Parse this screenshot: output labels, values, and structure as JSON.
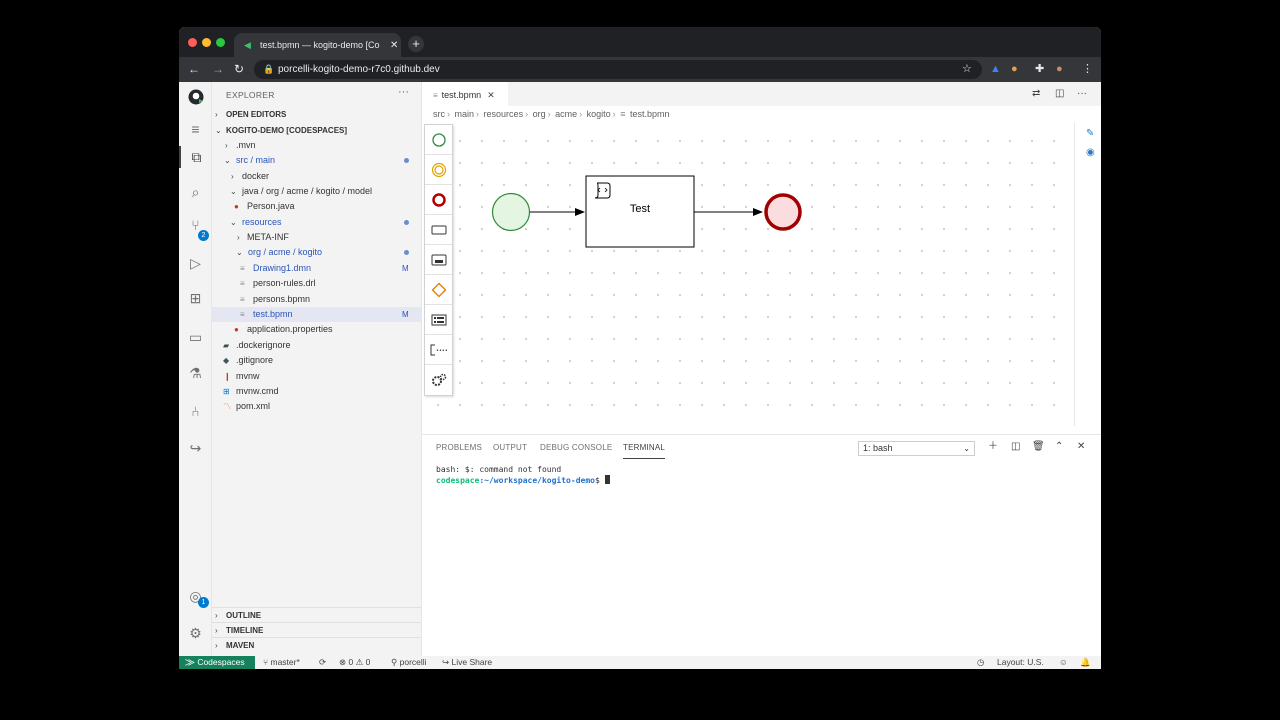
{
  "browser": {
    "tab_title": "test.bpmn — kogito-demo [Co",
    "tab_close": "✕",
    "new_tab": "+",
    "url": "porcelli-kogito-demo-r7c0.github.dev",
    "traffic_colors": [
      "#ff5f57",
      "#febc2e",
      "#28c840"
    ]
  },
  "sidebar": {
    "title": "EXPLORER",
    "more": "···",
    "open_editors": "OPEN EDITORS",
    "workspace": "KOGITO-DEMO [CODESPACES]",
    "tree": [
      {
        "label": ".mvn",
        "modified": false
      },
      {
        "label": "src / main",
        "modified": true
      },
      {
        "label": "docker",
        "modified": false
      },
      {
        "label": "java / org / acme / kogito / model",
        "modified": false
      },
      {
        "label": "Person.java",
        "modified": false
      },
      {
        "label": "resources",
        "modified": true
      },
      {
        "label": "META-INF",
        "modified": false
      },
      {
        "label": "org / acme / kogito",
        "modified": true
      },
      {
        "label": "Drawing1.dmn",
        "modified": true,
        "badge": "M"
      },
      {
        "label": "person-rules.drl",
        "modified": false
      },
      {
        "label": "persons.bpmn",
        "modified": false
      },
      {
        "label": "test.bpmn",
        "modified": true,
        "badge": "M"
      },
      {
        "label": "application.properties",
        "modified": false
      },
      {
        "label": ".dockerignore",
        "modified": false
      },
      {
        "label": ".gitignore",
        "modified": false
      },
      {
        "label": "mvnw",
        "modified": false
      },
      {
        "label": "mvnw.cmd",
        "modified": false
      },
      {
        "label": "pom.xml",
        "modified": false
      }
    ],
    "outline": "OUTLINE",
    "timeline": "TIMELINE",
    "maven": "MAVEN"
  },
  "activity_badges": {
    "scm": "2",
    "accounts": "1"
  },
  "editor": {
    "tab_label": "test.bpmn",
    "breadcrumb": [
      "src",
      "main",
      "resources",
      "org",
      "acme",
      "kogito",
      "test.bpmn"
    ],
    "diagram": {
      "task_label": "Test"
    }
  },
  "panel": {
    "tabs": [
      "PROBLEMS",
      "OUTPUT",
      "DEBUG CONSOLE",
      "TERMINAL"
    ],
    "active_tab": "TERMINAL",
    "terminal_select": "1: bash",
    "terminal_lines": {
      "line1": "bash: $: command not found",
      "prompt_user": "codespace",
      "prompt_path": ":~/workspace/kogito-demo",
      "prompt_symbol": "$ "
    }
  },
  "status": {
    "remote": "Codespaces",
    "branch": "master*",
    "errors": "0",
    "warnings": "0",
    "user": "porcelli",
    "live_share": "Live Share",
    "layout": "Layout: U.S."
  },
  "colors": {
    "accent": "#007acc",
    "remote_bg": "#16825d",
    "start_event": "#2e8b3a",
    "end_event": "#a00000"
  }
}
